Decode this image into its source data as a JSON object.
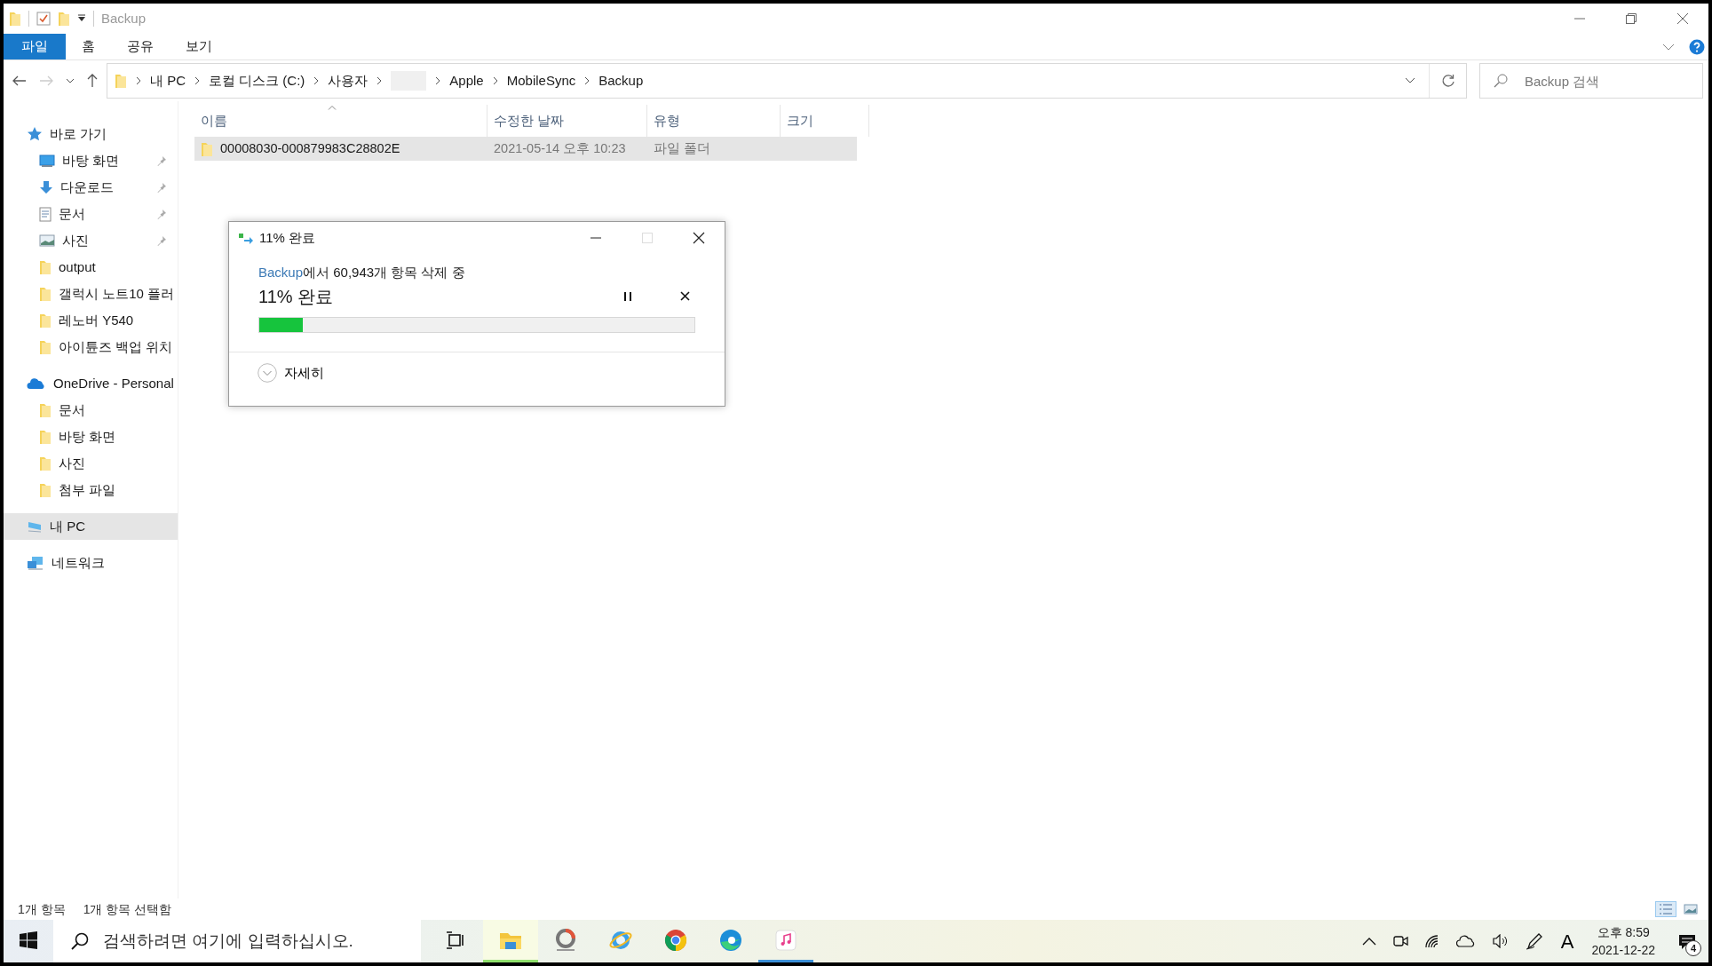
{
  "window": {
    "title": "Backup"
  },
  "ribbon_tabs": [
    {
      "label": "파일",
      "selected": true
    },
    {
      "label": "홈",
      "selected": false
    },
    {
      "label": "공유",
      "selected": false
    },
    {
      "label": "보기",
      "selected": false
    }
  ],
  "address": {
    "crumbs": [
      {
        "kind": "text",
        "label": "내 PC"
      },
      {
        "kind": "text",
        "label": "로컬 디스크 (C:)"
      },
      {
        "kind": "text",
        "label": "사용자"
      },
      {
        "kind": "redacted"
      },
      {
        "kind": "text",
        "label": "Apple"
      },
      {
        "kind": "text",
        "label": "MobileSync"
      },
      {
        "kind": "text",
        "label": "Backup"
      }
    ]
  },
  "search": {
    "placeholder": "Backup 검색"
  },
  "sidebar": {
    "sections": [
      {
        "kind": "star",
        "label": "바로 가기",
        "selected": false,
        "children": [
          {
            "kind": "desktop",
            "label": "바탕 화면",
            "pinned": true,
            "selected": false
          },
          {
            "kind": "download",
            "label": "다운로드",
            "pinned": true,
            "selected": false
          },
          {
            "kind": "document",
            "label": "문서",
            "pinned": true,
            "selected": false
          },
          {
            "kind": "picture",
            "label": "사진",
            "pinned": true,
            "selected": false
          },
          {
            "kind": "folder",
            "label": "output",
            "pinned": false,
            "selected": false
          },
          {
            "kind": "folder",
            "label": "갤럭시 노트10 플러",
            "pinned": false,
            "selected": false
          },
          {
            "kind": "folder",
            "label": "레노버 Y540",
            "pinned": false,
            "selected": false
          },
          {
            "kind": "folder",
            "label": "아이튠즈 백업 위치",
            "pinned": false,
            "selected": false
          }
        ]
      },
      {
        "kind": "cloud",
        "label": "OneDrive - Personal",
        "selected": false,
        "children": [
          {
            "kind": "folder",
            "label": "문서",
            "pinned": false,
            "selected": false
          },
          {
            "kind": "folder",
            "label": "바탕 화면",
            "pinned": false,
            "selected": false
          },
          {
            "kind": "folder",
            "label": "사진",
            "pinned": false,
            "selected": false
          },
          {
            "kind": "folder",
            "label": "첨부 파일",
            "pinned": false,
            "selected": false
          }
        ]
      },
      {
        "kind": "computer",
        "label": "내 PC",
        "selected": true
      },
      {
        "kind": "network",
        "label": "네트워크",
        "selected": false
      }
    ]
  },
  "table": {
    "columns": [
      {
        "label": "이름",
        "sorted": true
      },
      {
        "label": "수정한 날짜",
        "sorted": false
      },
      {
        "label": "유형",
        "sorted": false
      },
      {
        "label": "크기",
        "sorted": false
      }
    ],
    "rows": [
      {
        "name": "00008030-000879983C28802E",
        "modified": "2021-05-14 오후 10:23",
        "type": "파일 폴더",
        "selected": true
      }
    ]
  },
  "dialog": {
    "title": "11% 완료",
    "source_link": "Backup",
    "message": "에서 60,943개 항목 삭제 중",
    "heading": "11% 완료",
    "level": 0.1,
    "details_label": "자세히"
  },
  "status_bar": {
    "items": [
      "1개 항목",
      "1개 항목 선택함"
    ],
    "views": [
      {
        "kind": "details",
        "selected": true
      },
      {
        "kind": "thumbnails",
        "selected": false
      }
    ]
  },
  "taskbar": {
    "search_placeholder": "검색하려면 여기에 입력하십시오.",
    "apps": [
      {
        "kind": "explorer",
        "active": true,
        "running": true
      },
      {
        "kind": "ring",
        "active": false,
        "running": false
      },
      {
        "kind": "globe",
        "active": false,
        "running": false
      },
      {
        "kind": "wheel",
        "active": false,
        "running": false
      },
      {
        "kind": "swirl",
        "active": false,
        "running": false
      },
      {
        "kind": "music",
        "active": false,
        "running": true
      }
    ],
    "ime": "A",
    "time": "오후 8:59",
    "date": "2021-12-22",
    "notifications": "4"
  }
}
